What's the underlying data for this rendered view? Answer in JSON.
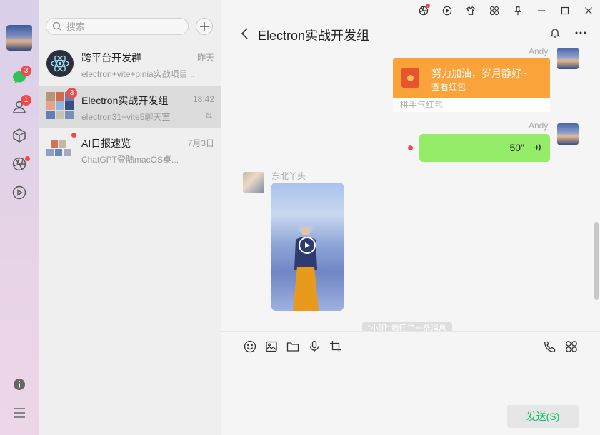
{
  "sidebar": {
    "chat_badge": "3",
    "contacts_badge": "1"
  },
  "search": {
    "placeholder": "搜索"
  },
  "conversations": [
    {
      "title": "跨平台开发群",
      "time": "昨天",
      "preview": "electron+vite+pinia实战项目..."
    },
    {
      "title": "Electron实战开发组",
      "time": "18:42",
      "preview": "electron31+vite5聊天室",
      "badge": "3"
    },
    {
      "title": "AI日报速览",
      "time": "7月3日",
      "preview": "ChatGPT登陆macOS桌..."
    }
  ],
  "chat": {
    "title": "Electron实战开发组",
    "messages": {
      "redpacket": {
        "sender": "Andy",
        "text": "努力加油，岁月静好~",
        "action": "查看红包",
        "footer": "拼手气红包"
      },
      "voice": {
        "sender": "Andy",
        "duration": "50\""
      },
      "video": {
        "sender": "东北丫头"
      },
      "system": "\"小明\" 撤回了一条消息"
    },
    "send_label": "发送(S)"
  },
  "colors": {
    "accent_green": "#07c160",
    "voice_bubble": "#95ec69",
    "redpacket": "#f9a33a",
    "badge": "#f04b4b"
  },
  "icons": {
    "rail": [
      "chat-icon",
      "contacts-icon",
      "cube-icon",
      "aperture-icon",
      "play-icon",
      "info-icon",
      "menu-icon"
    ],
    "window": [
      "aperture-icon",
      "play-icon",
      "shirt-icon",
      "apps-icon",
      "pin-icon",
      "minimize-icon",
      "maximize-icon",
      "close-icon"
    ],
    "toolbar": [
      "emoji-icon",
      "image-icon",
      "folder-icon",
      "mic-icon",
      "crop-icon",
      "phone-icon",
      "apps-icon"
    ]
  }
}
